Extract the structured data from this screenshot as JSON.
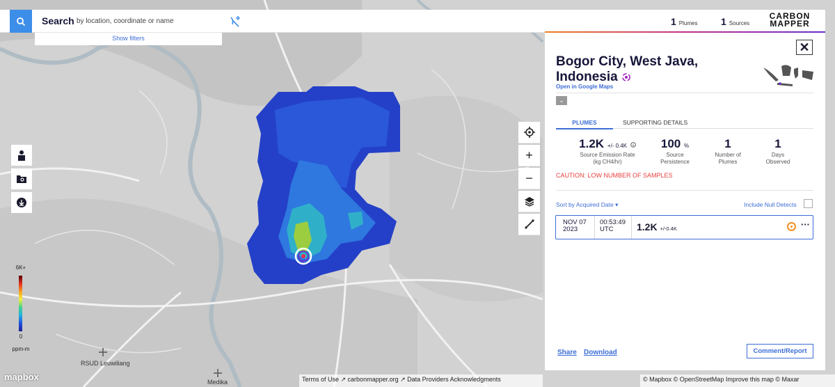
{
  "search": {
    "label": "Search",
    "placeholder": "by location, coordinate or name",
    "show_filters": "Show filters"
  },
  "header_stats": {
    "plumes_count": "1",
    "plumes_label": "Plumes",
    "sources_count": "1",
    "sources_label": "Sources"
  },
  "logo": {
    "line1": "CARBON",
    "line2": "MAPPER"
  },
  "legend": {
    "max": "6K+",
    "min": "0",
    "unit": "ppm-m"
  },
  "map_labels": {
    "place": "RSUD Leuwiliang",
    "place2": "Medika"
  },
  "panel": {
    "close": "✕",
    "title": "Bogor City, West Java, Indonesia",
    "google_maps": "Open in Google Maps",
    "tabs": [
      "PLUMES",
      "SUPPORTING DETAILS"
    ],
    "metrics": [
      {
        "value": "1.2K",
        "extra": "+/- 0.4K",
        "label1": "Source Emission Rate",
        "label2": "(kg CH4/hr)"
      },
      {
        "value": "100",
        "extra": "%",
        "label1": "Source",
        "label2": "Persistence"
      },
      {
        "value": "1",
        "extra": "",
        "label1": "Number of",
        "label2": "Plumes"
      },
      {
        "value": "1",
        "extra": "",
        "label1": "Days",
        "label2": "Observed"
      }
    ],
    "caution": "CAUTION: LOW NUMBER OF SAMPLES",
    "sort": "Sort by Acquired Date",
    "null_detects": "Include Null Detects",
    "row": {
      "date1": "NOV 07",
      "date2": "2023",
      "time1": "00:53:49",
      "time2": "UTC",
      "emission": "1.2K",
      "emission_err": "+/-0.4K"
    },
    "share": "Share",
    "download": "Download",
    "comment": "Comment/Report"
  },
  "footer": {
    "mapbox": "mapbox",
    "attr_left": "Terms of Use ↗   carbonmapper.org ↗   Data Providers   Acknowledgments",
    "attr_right": "© Mapbox © OpenStreetMap  Improve this map © Maxar"
  },
  "colors": {
    "accent": "#3d8ee8",
    "link": "#3d6dd6",
    "caution": "#e84040",
    "target": "#f09020"
  }
}
